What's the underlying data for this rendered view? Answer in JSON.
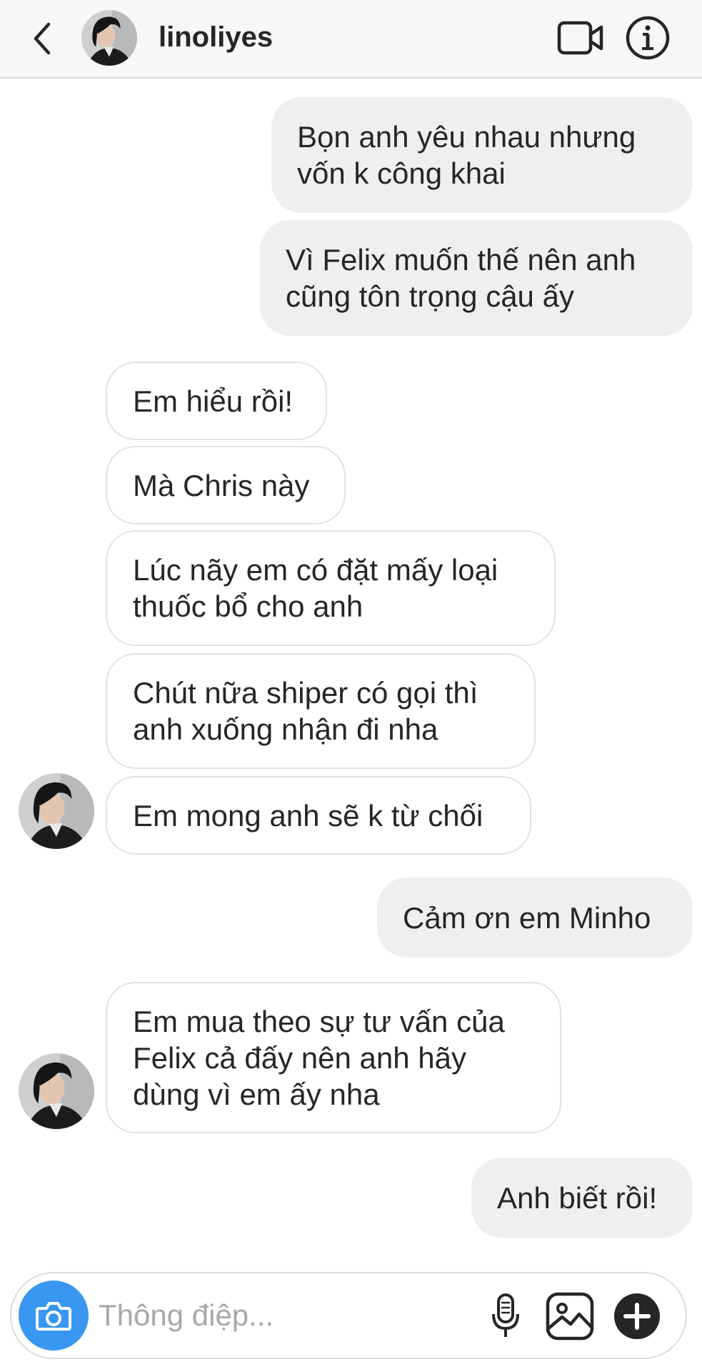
{
  "header": {
    "back_icon": "chevron-left-icon",
    "username": "linoliyes",
    "video_icon": "video-camera-icon",
    "info_icon": "info-icon"
  },
  "messages": [
    {
      "side": "out",
      "text": "Bọn anh yêu nhau nhưng\nvốn k công khai"
    },
    {
      "side": "out",
      "text": "Vì Felix muốn thế nên anh\ncũng tôn trọng cậu ấy"
    },
    {
      "side": "in",
      "text": "Em hiểu rồi!"
    },
    {
      "side": "in",
      "text": "Mà Chris này"
    },
    {
      "side": "in",
      "text": "Lúc nãy em có đặt mấy loại\nthuốc bổ cho anh"
    },
    {
      "side": "in",
      "text": "Chút nữa shiper có gọi thì\nanh xuống nhận đi nha"
    },
    {
      "side": "in",
      "text": "Em mong anh sẽ k từ chối"
    },
    {
      "side": "out",
      "text": "Cảm ơn em Minho"
    },
    {
      "side": "in",
      "text": "Em mua theo sự tư vấn của\nFelix cả đấy nên anh hãy\ndùng vì em ấy nha"
    },
    {
      "side": "out",
      "text": "Anh biết rồi!"
    }
  ],
  "composer": {
    "camera_icon": "camera-icon",
    "placeholder": "Thông điệp...",
    "value": "",
    "mic_icon": "microphone-icon",
    "gallery_icon": "image-gallery-icon",
    "plus_icon": "plus-circle-icon"
  },
  "colors": {
    "outgoing_bubble": "#efefef",
    "incoming_bubble_border": "#e2e2e2",
    "camera_button": "#3897f0",
    "text": "#262626",
    "placeholder": "#a8a8a8"
  }
}
